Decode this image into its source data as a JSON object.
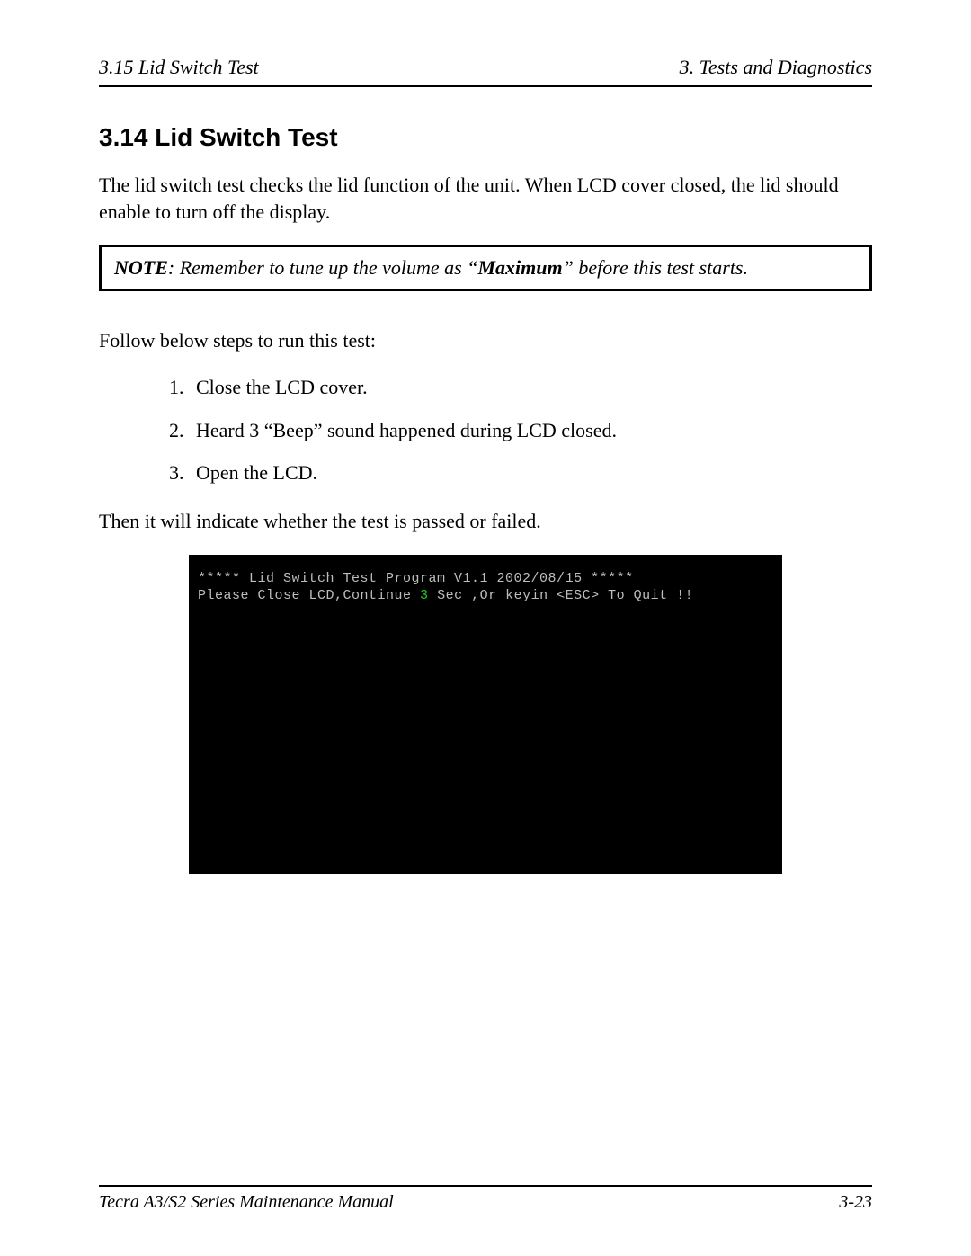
{
  "header": {
    "left": "3.15  Lid Switch Test",
    "right": "3.  Tests and Diagnostics"
  },
  "section": {
    "heading": "3.14  Lid Switch Test",
    "intro": "The lid switch test checks the lid function of the unit. When LCD cover closed, the lid should enable to turn off the display.",
    "note_label": "NOTE",
    "note_before": ":  Remember to tune up the volume as “",
    "note_bold": "Maximum",
    "note_after": "” before this test starts.",
    "follow": "Follow below steps to run this test:",
    "steps": [
      "Close the LCD cover.",
      "Heard 3 “Beep” sound happened during LCD closed.",
      "Open the LCD."
    ],
    "result_line": "Then it will indicate whether the test is passed or failed."
  },
  "terminal": {
    "line1": "***** Lid Switch Test Program V1.1 2002/08/15 *****",
    "line2a": "Please Close LCD,Continue ",
    "line2b": "3",
    "line2c": " Sec ,Or keyin <ESC> To Quit !!"
  },
  "footer": {
    "left": "Tecra A3/S2 Series Maintenance Manual",
    "right": "3-23"
  }
}
